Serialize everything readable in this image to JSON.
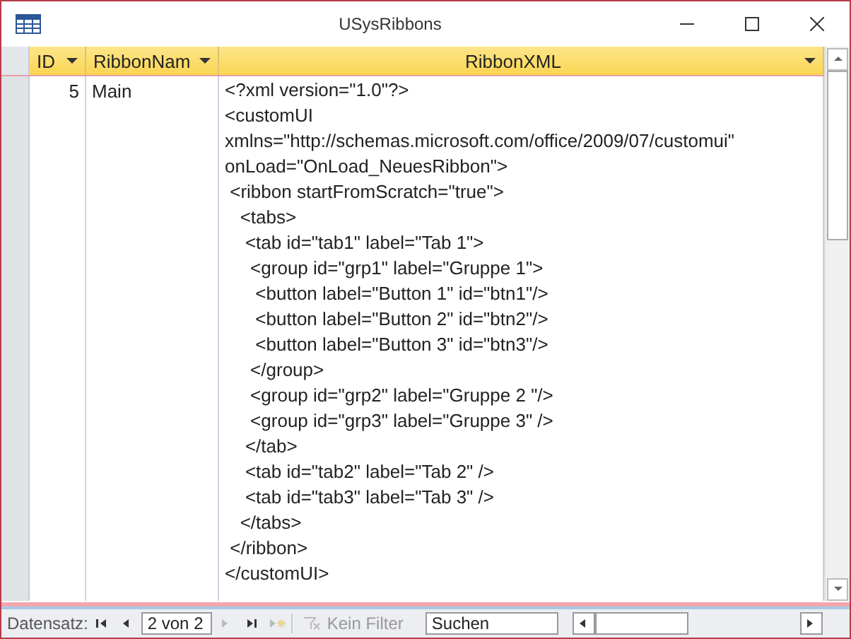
{
  "window": {
    "title": "USysRibbons"
  },
  "table": {
    "columns": [
      {
        "label": "ID"
      },
      {
        "label": "RibbonNam"
      },
      {
        "label": "RibbonXML"
      }
    ],
    "rows": [
      {
        "id": "5",
        "name": "Main",
        "xml": [
          "<?xml version=\"1.0\"?>",
          "<customUI",
          "xmlns=\"http://schemas.microsoft.com/office/2009/07/customui\"",
          "onLoad=\"OnLoad_NeuesRibbon\">",
          " <ribbon startFromScratch=\"true\">",
          "   <tabs>",
          "    <tab id=\"tab1\" label=\"Tab 1\">",
          "     <group id=\"grp1\" label=\"Gruppe 1\">",
          "      <button label=\"Button 1\" id=\"btn1\"/>",
          "      <button label=\"Button 2\" id=\"btn2\"/>",
          "      <button label=\"Button 3\" id=\"btn3\"/>",
          "     </group>",
          "     <group id=\"grp2\" label=\"Gruppe 2 \"/>",
          "     <group id=\"grp3\" label=\"Gruppe 3\" />",
          "    </tab>",
          "    <tab id=\"tab2\" label=\"Tab 2\" />",
          "    <tab id=\"tab3\" label=\"Tab 3\" />",
          "   </tabs>",
          " </ribbon>",
          "</customUI>"
        ]
      }
    ]
  },
  "navigation": {
    "label": "Datensatz:",
    "position": "2 von 2",
    "first_disabled": false,
    "prev_disabled": false,
    "next_disabled": true,
    "last_disabled": false,
    "new_disabled": true,
    "filter": {
      "label": "Kein Filter",
      "disabled": true
    },
    "search": {
      "placeholder": "Suchen"
    }
  }
}
